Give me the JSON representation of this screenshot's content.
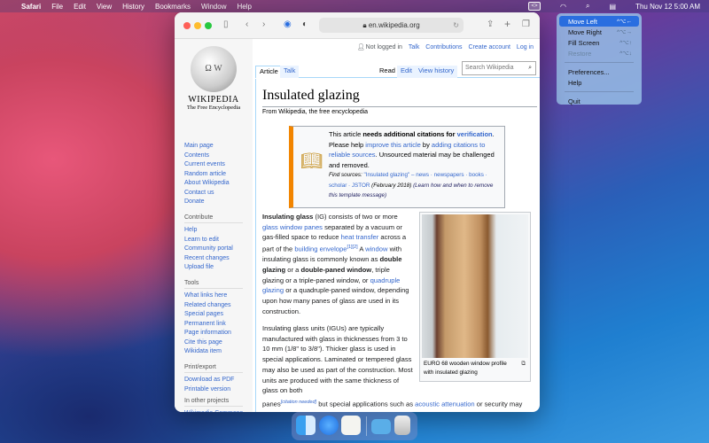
{
  "menubar": {
    "app": "Safari",
    "items": [
      "File",
      "Edit",
      "View",
      "History",
      "Bookmarks",
      "Window",
      "Help"
    ],
    "clock": "Thu Nov 12  5:00 AM"
  },
  "dropdown": [
    {
      "label": "Move Left",
      "shortcut": "^⌥←",
      "state": "selected"
    },
    {
      "label": "Move Right",
      "shortcut": "^⌥→",
      "state": "normal"
    },
    {
      "label": "Fill Screen",
      "shortcut": "^⌥↑",
      "state": "normal"
    },
    {
      "label": "Restore",
      "shortcut": "^⌥↓",
      "state": "disabled"
    },
    {
      "label": "Preferences...",
      "shortcut": "",
      "state": "normal"
    },
    {
      "label": "Help",
      "shortcut": "",
      "state": "normal"
    },
    {
      "label": "Quit",
      "shortcut": "",
      "state": "normal"
    }
  ],
  "browser": {
    "url": "en.wikipedia.org"
  },
  "wiki": {
    "logo_title": "WIKIPEDIA",
    "logo_subtitle": "The Free Encyclopedia",
    "user": {
      "not_logged": "Not logged in",
      "links": [
        "Talk",
        "Contributions",
        "Create account",
        "Log in"
      ]
    },
    "tabs_left": [
      "Article",
      "Talk"
    ],
    "tabs_right": [
      "Read",
      "Edit",
      "View history"
    ],
    "search_placeholder": "Search Wikipedia",
    "nav_main": [
      "Main page",
      "Contents",
      "Current events",
      "Random article",
      "About Wikipedia",
      "Contact us",
      "Donate"
    ],
    "contribute": {
      "heading": "Contribute",
      "items": [
        "Help",
        "Learn to edit",
        "Community portal",
        "Recent changes",
        "Upload file"
      ]
    },
    "tools": {
      "heading": "Tools",
      "items": [
        "What links here",
        "Related changes",
        "Special pages",
        "Permanent link",
        "Page information",
        "Cite this page",
        "Wikidata item"
      ]
    },
    "print": {
      "heading": "Print/export",
      "items": [
        "Download as PDF",
        "Printable version"
      ]
    },
    "other": {
      "heading": "In other projects",
      "items": [
        "Wikimedia Commons"
      ]
    },
    "title": "Insulated glazing",
    "from": "From Wikipedia, the free encyclopedia",
    "ambox": {
      "t1": "This article ",
      "b1": "needs additional citations for",
      "l1": "verification",
      "t2": ". Please help ",
      "l2": "improve this article",
      "t3": " by ",
      "l3": "adding citations to reliable sources",
      "t4": ". Unsourced material may be challenged and removed.",
      "fs_label": "Find sources: ",
      "fs_links": "\"Insulated glazing\" – news · newspapers · books · scholar · JSTOR",
      "fs_date": " (February 2018) ",
      "fs_learn": "(Learn how and when to remove this template message)"
    },
    "p1": {
      "b1": "Insulating glass",
      "t1": " (IG) consists of two or more ",
      "l1": "glass window panes",
      "t2": " separated by a vacuum or gas-filled space to reduce ",
      "l2": "heat transfer",
      "t3": " across a part of the ",
      "l3": "building envelope",
      "sup": "[1][2]",
      "t4": " A ",
      "l4": "window",
      "t5": " with insulating glass is commonly known as ",
      "b2": "double glazing",
      "t6": " or a ",
      "b3": "double-paned window",
      "t7": ", triple glazing or a triple-paned window, or ",
      "l5": "quadruple glazing",
      "t8": " or a quadruple-paned window, depending upon how many panes of glass are used in its construction."
    },
    "p2": "Insulating glass units (IGUs) are typically manufactured with glass in thicknesses from 3 to 10 mm (1/8\" to 3/8\"). Thicker glass is used in special applications. Laminated or tempered glass may also be used as part of the construction. Most units are produced with the same thickness of glass on both",
    "p3": {
      "t1": "panes",
      "sup": "[citation needed]",
      "t2": " but special applications such as ",
      "l1": "acoustic attenuation",
      "t3": " or security may"
    },
    "caption": "EURO 68 wooden window profile with insulated glazing"
  }
}
